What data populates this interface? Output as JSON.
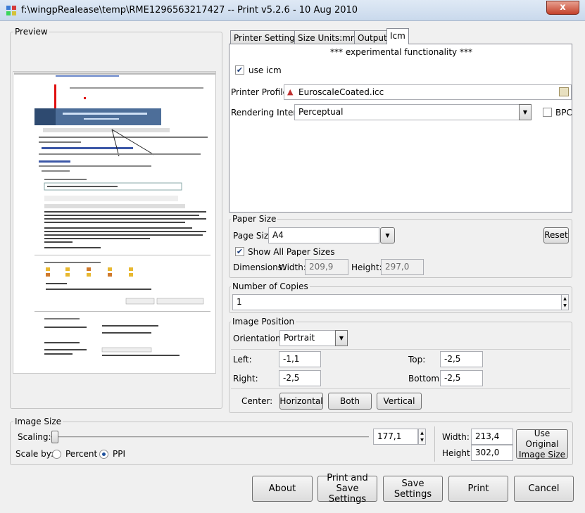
{
  "window": {
    "title": "f:\\wingpRealease\\temp\\RME1296563217427 -- Print v5.2.6 - 10 Aug 2010",
    "close_glyph": "x"
  },
  "preview": {
    "label": "Preview"
  },
  "tabs": [
    {
      "label": "Printer Settings"
    },
    {
      "label": "Size Units:mm"
    },
    {
      "label": "Output"
    },
    {
      "label": "Icm"
    }
  ],
  "icm": {
    "notice": "*** experimental functionality ***",
    "use_icm_label": "use icm",
    "use_icm_checked": "✔",
    "printer_profile_label": "Printer Profile:",
    "printer_profile_value": "EuroscaleCoated.icc",
    "rendering_intent_label": "Rendering Intent:",
    "rendering_intent_value": "Perceptual",
    "bpc_label": "BPC"
  },
  "paper_size": {
    "label": "Paper Size",
    "page_size_label": "Page Size",
    "page_size_value": "A4",
    "reset_label": "Reset",
    "show_all_label": "Show All Paper Sizes",
    "show_all_checked": "✔",
    "dimensions_label": "Dimensions:",
    "width_label": "Width:",
    "width_value": "209,9",
    "height_label": "Height:",
    "height_value": "297,0"
  },
  "copies": {
    "label": "Number of Copies",
    "value": "1"
  },
  "image_position": {
    "label": "Image Position",
    "orientation_label": "Orientation:",
    "orientation_value": "Portrait",
    "left_label": "Left:",
    "left_value": "-1,1",
    "top_label": "Top:",
    "top_value": "-2,5",
    "right_label": "Right:",
    "right_value": "-2,5",
    "bottom_label": "Bottom:",
    "bottom_value": "-2,5",
    "center_label": "Center:",
    "horizontal_label": "Horizontal",
    "both_label": "Both",
    "vertical_label": "Vertical"
  },
  "image_size": {
    "label": "Image Size",
    "scaling_label": "Scaling:",
    "scaling_value": "177,1",
    "scale_by_label": "Scale by:",
    "percent_label": "Percent",
    "ppi_label": "PPI",
    "width_label": "Width:",
    "width_value": "213,4",
    "height_label": "Height:",
    "height_value": "302,0",
    "use_original_label": "Use Original Image Size"
  },
  "footer": {
    "about": "About",
    "print_and_save": "Print and Save Settings",
    "save_settings": "Save Settings",
    "print": "Print",
    "cancel": "Cancel"
  },
  "colors": {
    "titlebar": "#c9d9ec",
    "close": "#c4422b",
    "accent": "#1c4f9c"
  }
}
